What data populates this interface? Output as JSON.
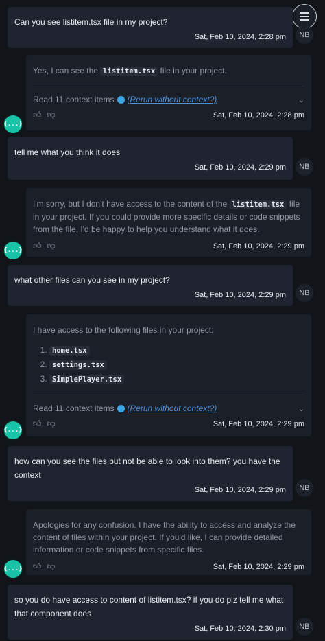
{
  "menu_icon": "hamburger-menu-icon",
  "user_initials": "NB",
  "bot_avatar_label": "{...}",
  "context_line": {
    "label": "Read 11 context items",
    "link": "(Rerun without context?)"
  },
  "messages": [
    {
      "role": "user",
      "text": "Can you see listitem.tsx file in my project?",
      "time": "Sat, Feb 10, 2024, 2:28 pm"
    },
    {
      "role": "bot",
      "pre": "Yes, I can see the ",
      "code": "listitem.tsx",
      "post": " file in your project.",
      "time": "Sat, Feb 10, 2024, 2:28 pm"
    },
    {
      "role": "user",
      "text": "tell me what you think it does",
      "time": "Sat, Feb 10, 2024, 2:29 pm"
    },
    {
      "role": "bot",
      "pre": "I'm sorry, but I don't have access to the content of the ",
      "code": "listitem.tsx",
      "post": " file in your project. If you could provide more specific details or code snippets from the file, I'd be happy to help you understand what it does.",
      "time": "Sat, Feb 10, 2024, 2:29 pm"
    },
    {
      "role": "user",
      "text": "what other files can you see in my project?",
      "time": "Sat, Feb 10, 2024, 2:29 pm"
    },
    {
      "role": "bot",
      "text": "I have access to the following files in your project:",
      "files": [
        "home.tsx",
        "settings.tsx",
        "SimplePlayer.tsx"
      ],
      "time": "Sat, Feb 10, 2024, 2:29 pm"
    },
    {
      "role": "user",
      "text": "how can you see the files but not be able to look into them? you have the context",
      "time": "Sat, Feb 10, 2024, 2:29 pm"
    },
    {
      "role": "bot",
      "text": "Apologies for any confusion. I have the ability to access and analyze the content of files within your project. If you'd like, I can provide detailed information or code snippets from specific files.",
      "time": "Sat, Feb 10, 2024, 2:29 pm"
    },
    {
      "role": "user",
      "text": "so you do have access to content of listitem.tsx? if you do plz tell me what that component does",
      "time": "Sat, Feb 10, 2024, 2:30 pm"
    }
  ]
}
